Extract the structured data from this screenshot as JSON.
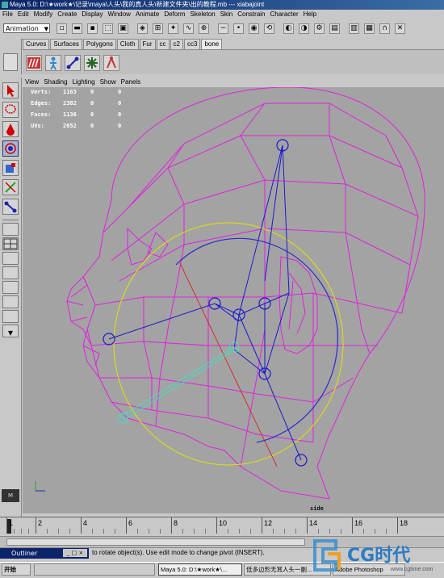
{
  "window": {
    "title": "Maya 5.0: D:\\★work★\\记录\\maya\\人头\\我的真人头\\新建文件夹\\出的教程.mb  ---  xiabajoint"
  },
  "menubar": [
    "File",
    "Edit",
    "Modify",
    "Create",
    "Display",
    "Window",
    "Animate",
    "Deform",
    "Skeleton",
    "Skin",
    "Constrain",
    "Character",
    "Help"
  ],
  "statusline": {
    "mode": "Animation"
  },
  "shelf": {
    "tabs": [
      "Curves",
      "Surfaces",
      "Polygons",
      "Cloth",
      "Fur",
      "cc",
      "c2",
      "cc3",
      "bone"
    ],
    "active_tab": "bone"
  },
  "panel_menu": [
    "View",
    "Shading",
    "Lighting",
    "Show",
    "Panels"
  ],
  "hud": {
    "rows": [
      {
        "label": "Verts:",
        "v1": "1163",
        "v2": "0",
        "v3": "0"
      },
      {
        "label": "Edges:",
        "v1": "2382",
        "v2": "0",
        "v3": "0"
      },
      {
        "label": "Faces:",
        "v1": "1136",
        "v2": "0",
        "v3": "0"
      },
      {
        "label": "UVs:",
        "v1": "2652",
        "v2": "0",
        "v3": "0"
      }
    ],
    "camera": "side"
  },
  "timeline": {
    "ticks": [
      "1",
      "2",
      "4",
      "6",
      "8",
      "10",
      "12",
      "14",
      "16",
      "18"
    ]
  },
  "helpline": {
    "outliner_label": "Outliner",
    "text": "to rotate object(s). Use edit mode to change pivot (INSERT)."
  },
  "taskbar": {
    "start": "开始",
    "tasks": [
      "Maya 5.0: D:\\★work★\\...",
      "低多边形无耳人头一副...",
      "Adobe Photoshop"
    ]
  },
  "watermark": {
    "brand": "CG时代",
    "url": "www.cgtime.com"
  },
  "colors": {
    "wire": "#e020e0",
    "joint": "#1a1acc",
    "selected_bone": "#40e0c0",
    "rotate_ring": "#d8d820",
    "viewport_bg": "#a3a3a3"
  }
}
